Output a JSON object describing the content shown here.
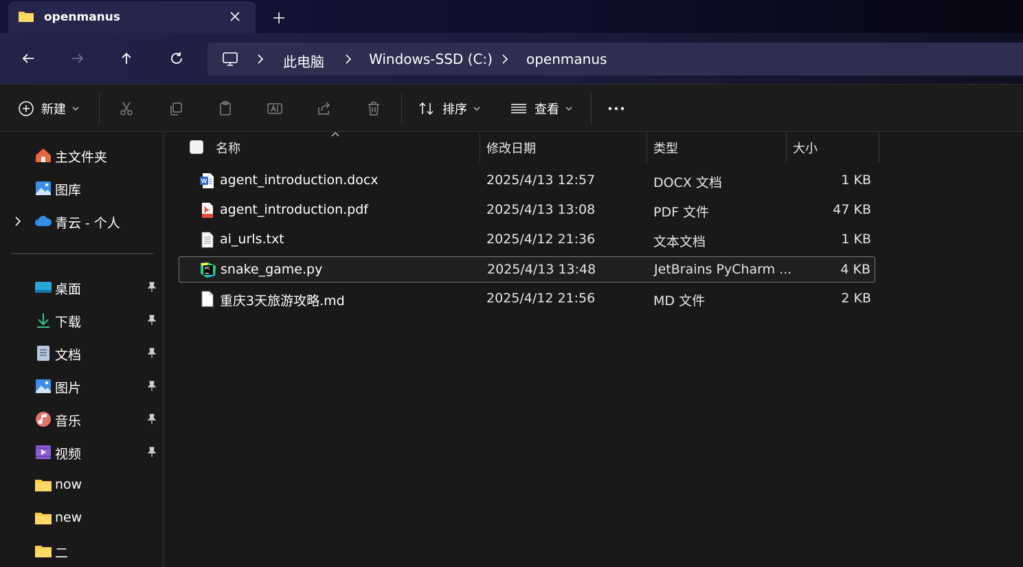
{
  "window": {
    "tab_title": "openmanus"
  },
  "breadcrumb": [
    "此电脑",
    "Windows-SSD (C:)",
    "openmanus"
  ],
  "toolbar": {
    "new_label": "新建",
    "sort_label": "排序",
    "view_label": "查看"
  },
  "sidebar": {
    "items": [
      {
        "label": "主文件夹",
        "icon": "home-icon"
      },
      {
        "label": "图库",
        "icon": "gallery-icon"
      },
      {
        "label": "青云 - 个人",
        "icon": "onedrive-cloud-icon"
      },
      {
        "label": "桌面",
        "icon": "desktop-icon"
      },
      {
        "label": "下载",
        "icon": "download-icon"
      },
      {
        "label": "文档",
        "icon": "document-icon"
      },
      {
        "label": "图片",
        "icon": "pictures-icon"
      },
      {
        "label": "音乐",
        "icon": "music-icon"
      },
      {
        "label": "视频",
        "icon": "video-icon"
      },
      {
        "label": "now",
        "icon": "folder-icon"
      },
      {
        "label": "new",
        "icon": "folder-icon"
      },
      {
        "label": "二",
        "icon": "folder-icon"
      }
    ]
  },
  "columns": {
    "name": "名称",
    "modified": "修改日期",
    "type": "类型",
    "size": "大小"
  },
  "files": [
    {
      "name": "agent_introduction.docx",
      "modified": "2025/4/13 12:57",
      "type": "DOCX 文档",
      "size": "1 KB",
      "icon": "word-doc-icon"
    },
    {
      "name": "agent_introduction.pdf",
      "modified": "2025/4/13 13:08",
      "type": "PDF 文件",
      "size": "47 KB",
      "icon": "pdf-icon"
    },
    {
      "name": "ai_urls.txt",
      "modified": "2025/4/12 21:36",
      "type": "文本文档",
      "size": "1 KB",
      "icon": "text-file-icon"
    },
    {
      "name": "snake_game.py",
      "modified": "2025/4/13 13:48",
      "type": "JetBrains PyCharm ...",
      "size": "4 KB",
      "icon": "pycharm-icon",
      "selected": true
    },
    {
      "name": "重庆3天旅游攻略.md",
      "modified": "2025/4/12 21:56",
      "type": "MD 文件",
      "size": "2 KB",
      "icon": "blank-file-icon"
    }
  ],
  "colors": {
    "accent_folder": "#f7c948",
    "background": "#191919",
    "tab_active": "#26264d"
  }
}
